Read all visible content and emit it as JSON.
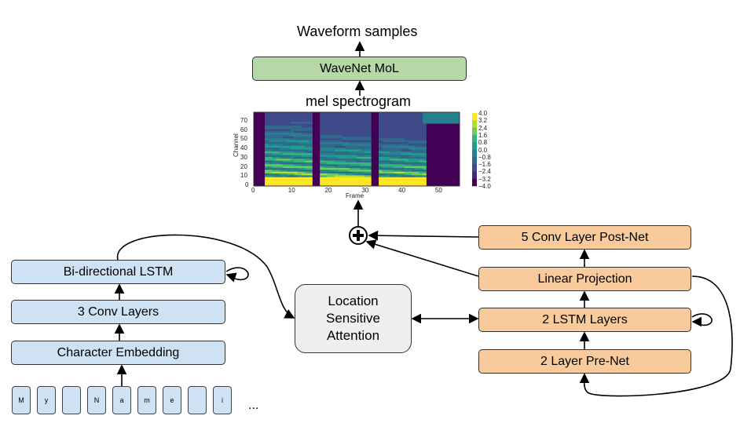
{
  "top": {
    "output_label": "Waveform samples",
    "vocoder": "WaveNet MoL",
    "spectrogram_label": "mel spectrogram"
  },
  "spectrogram": {
    "ylabel": "Channel",
    "xlabel": "Frame",
    "yticks": [
      "0",
      "10",
      "20",
      "30",
      "40",
      "50",
      "60",
      "70"
    ],
    "xticks": [
      "0",
      "10",
      "20",
      "30",
      "40",
      "50"
    ],
    "colorbar_ticks": [
      "4.0",
      "3.2",
      "2.4",
      "1.6",
      "0.8",
      "0.0",
      "−0.8",
      "−1.6",
      "−2.4",
      "−3.2",
      "−4.0"
    ],
    "colormap": "viridis"
  },
  "decoder": {
    "postnet": "5 Conv Layer Post-Net",
    "linear": "Linear Projection",
    "lstm": "2 LSTM Layers",
    "prenet": "2 Layer Pre-Net"
  },
  "attention": {
    "line1": "Location",
    "line2": "Sensitive",
    "line3": "Attention"
  },
  "encoder": {
    "bilstm": "Bi-directional LSTM",
    "conv": "3 Conv Layers",
    "embedding": "Character Embedding"
  },
  "characters": [
    "M",
    "y",
    "",
    "N",
    "a",
    "m",
    "e",
    "",
    "i"
  ],
  "ellipsis": "...",
  "colors": {
    "encoder": "#cfe2f3",
    "decoder": "#f9cb9c",
    "vocoder": "#b6d7a8",
    "attention": "#efefef"
  }
}
